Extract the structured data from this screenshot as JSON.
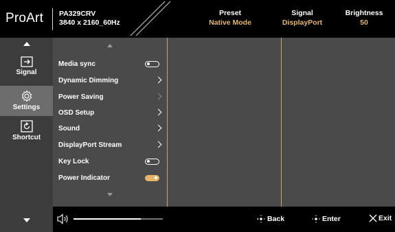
{
  "header": {
    "brand": "ProArt",
    "model": "PA329CRV",
    "resolution": "3840 x 2160_60Hz",
    "preset_label": "Preset",
    "preset_value": "Native Mode",
    "signal_label": "Signal",
    "signal_value": "DisplayPort",
    "brightness_label": "Brightness",
    "brightness_value": "50"
  },
  "nav": {
    "items": [
      {
        "label": "Signal",
        "icon": "input-icon"
      },
      {
        "label": "Settings",
        "icon": "gear-icon"
      },
      {
        "label": "Shortcut",
        "icon": "shortcut-icon"
      }
    ],
    "active": "Settings"
  },
  "menu": {
    "items": [
      {
        "label": "Media sync",
        "control": "toggle",
        "state": "off"
      },
      {
        "label": "Dynamic Dimming",
        "control": "chevron"
      },
      {
        "label": "Power Saving",
        "control": "chevron-dim"
      },
      {
        "label": "OSD Setup",
        "control": "chevron"
      },
      {
        "label": "Sound",
        "control": "chevron"
      },
      {
        "label": "DisplayPort Stream",
        "control": "chevron"
      },
      {
        "label": "Key Lock",
        "control": "toggle",
        "state": "off"
      },
      {
        "label": "Power Indicator",
        "control": "toggle",
        "state": "on"
      }
    ]
  },
  "bottom": {
    "volume_fraction": 0.75,
    "back_label": "Back",
    "enter_label": "Enter",
    "exit_label": "Exit"
  },
  "colors": {
    "accent": "#e6b56a",
    "panel": "#4a4a4a",
    "nav": "#3c3c3c",
    "nav_active": "#6d6d6d"
  }
}
